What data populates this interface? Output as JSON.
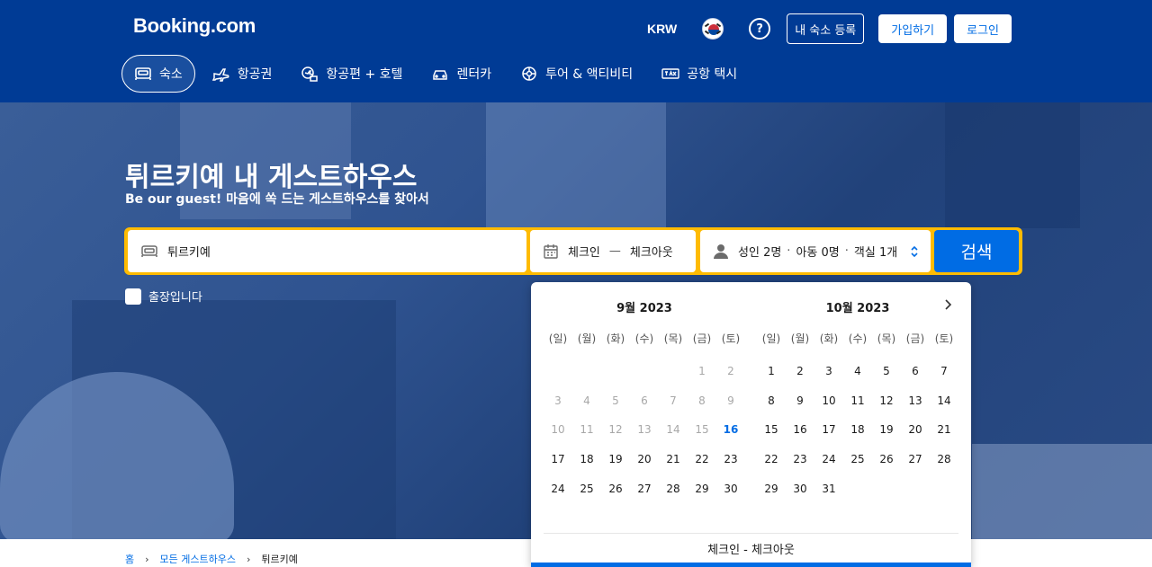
{
  "header": {
    "logo": "Booking.com",
    "currency": "KRW",
    "flag_icon": "south-korea-flag-icon",
    "help_label": "?",
    "list_property": "내 숙소 등록",
    "register": "가입하기",
    "login": "로그인"
  },
  "nav": [
    {
      "label": "숙소",
      "icon": "bed-icon",
      "active": true
    },
    {
      "label": "항공권",
      "icon": "plane-icon"
    },
    {
      "label": "항공편 + 호텔",
      "icon": "plane-hotel-icon"
    },
    {
      "label": "렌터카",
      "icon": "car-icon"
    },
    {
      "label": "투어 & 액티비티",
      "icon": "attractions-icon"
    },
    {
      "label": "공항 택시",
      "icon": "taxi-icon"
    }
  ],
  "hero": {
    "title": "튀르키예 내 게스트하우스",
    "subtitle": "Be our guest! 마음에 쏙 드는 게스트하우스를 찾아서"
  },
  "search": {
    "destination": "튀르키예",
    "checkin": "체크인",
    "dash": "—",
    "checkout": "체크아웃",
    "adults_label": "성인",
    "adults": "2명",
    "children_label": "아동",
    "children": "0명",
    "rooms_label": "객실",
    "rooms": "1개",
    "dot": "·",
    "button": "검색"
  },
  "business_trip": "출장입니다",
  "calendar": {
    "weekdays": [
      "(일)",
      "(월)",
      "(화)",
      "(수)",
      "(목)",
      "(금)",
      "(토)"
    ],
    "footer": "체크인 - 체크아웃",
    "months": [
      {
        "title": "9월 2023",
        "offset": 5,
        "days": 30,
        "today": 16
      },
      {
        "title": "10월 2023",
        "offset": 0,
        "days": 31,
        "today": 0
      }
    ],
    "colors": {
      "accent": "#006ce4",
      "past": "#a8a8a8"
    }
  },
  "breadcrumb": {
    "home": "홈",
    "all": "모든 게스트하우스",
    "current": "튀르키예",
    "sep": "›"
  }
}
